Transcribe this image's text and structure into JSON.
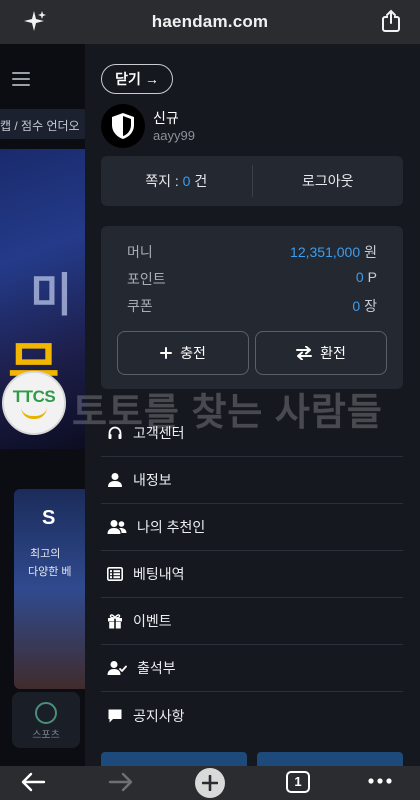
{
  "browser": {
    "url": "haendam.com",
    "tab_count": "1",
    "icons": [
      "sparkle-icon",
      "share-icon",
      "back-icon",
      "forward-icon",
      "new-tab-icon",
      "more-icon"
    ]
  },
  "background_page": {
    "breadcrumb": "캡 / 점수 언더오",
    "banner_text_1": "미",
    "banner_text_2": "무",
    "promo_title": "S",
    "promo_line_1": "최고의 ",
    "promo_line_2": "다양한 베",
    "sports_tab_label": "스포츠"
  },
  "drawer": {
    "close_label": "닫기 →",
    "user": {
      "rank": "신규",
      "id": "aayy99"
    },
    "messages": {
      "label": "쪽지 : ",
      "count": "0",
      "unit": " 건",
      "logout_label": "로그아웃"
    },
    "wallet": {
      "money_label": "머니",
      "money_value": "12,351,000",
      "money_unit": "원",
      "points_label": "포인트",
      "points_value": "0",
      "points_unit": "P",
      "coupon_label": "쿠폰",
      "coupon_value": "0",
      "coupon_unit": "장",
      "deposit_label": "충전",
      "withdraw_label": "환전"
    },
    "menu": [
      {
        "label": "고객센터",
        "icon": "headset-icon"
      },
      {
        "label": "내정보",
        "icon": "user-icon"
      },
      {
        "label": "나의 추천인",
        "icon": "users-icon"
      },
      {
        "label": "베팅내역",
        "icon": "list-icon"
      },
      {
        "label": "이벤트",
        "icon": "gift-icon"
      },
      {
        "label": "출석부",
        "icon": "user-check-icon"
      },
      {
        "label": "공지사항",
        "icon": "message-icon"
      }
    ]
  },
  "watermark": {
    "logo_text": "TTCS",
    "text": "토토를 찾는 사람들"
  },
  "colors": {
    "accent": "#3b9ef0",
    "drawer_bg": "#15181e",
    "card_bg": "#242830"
  }
}
